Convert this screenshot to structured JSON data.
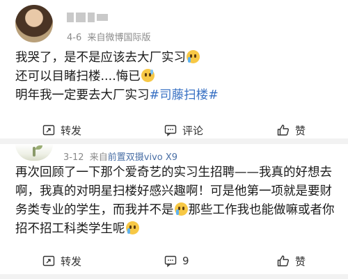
{
  "post1": {
    "meta_date": "4-6",
    "meta_source": "来自微博国际版",
    "content_lines": [
      "我哭了，是不是应该去大厂实习",
      "还可以目睹扫楼....悔已",
      "明年我一定要去大厂实习"
    ],
    "topic": "#司藤扫楼#",
    "emoji_cry": "crying-face-emoji",
    "emoji_sweat": "grinning-sweat-emoji",
    "actions": {
      "repost_label": "转发",
      "comment_label": "评论",
      "like_label": "赞"
    }
  },
  "post2": {
    "meta_date": "3-12",
    "meta_prefix": "来自",
    "meta_source": "前置双摄vivo X9",
    "content_part1": "再次回顾了一下那个爱奇艺的实习生招聘——我真的好想去啊，我真的对明星扫楼好感兴趣啊！可是他第一项就是要财务类专业的学生，而我并不是",
    "content_part2": "那些工作我也能做嘛或者你招不招工科类学生呢",
    "actions": {
      "repost_label": "转发",
      "comment_label": "9",
      "like_label": "赞"
    }
  },
  "icons": {
    "repost": "repost-icon",
    "comment": "comment-icon",
    "like": "thumbs-up-icon"
  },
  "colors": {
    "topic_blue": "#3a72c4",
    "meta_gray": "#8a8a8a",
    "divider": "#f2f2f2"
  }
}
